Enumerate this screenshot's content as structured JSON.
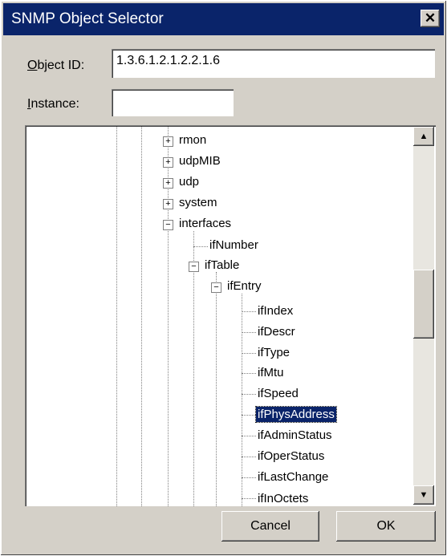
{
  "window": {
    "title": "SNMP Object Selector",
    "close_glyph": "✕"
  },
  "object_id": {
    "label_prefix": "O",
    "label_rest": "bject ID:",
    "value": "1.3.6.1.2.1.2.2.1.6"
  },
  "instance": {
    "label_prefix": "I",
    "label_rest": "nstance:",
    "value": ""
  },
  "tree": {
    "nodes": [
      {
        "label": "rmon",
        "expander": "+"
      },
      {
        "label": "udpMIB",
        "expander": "+"
      },
      {
        "label": "udp",
        "expander": "+"
      },
      {
        "label": "system",
        "expander": "+"
      },
      {
        "label": "interfaces",
        "expander": "−"
      },
      {
        "label": "ifNumber"
      },
      {
        "label": "ifTable",
        "expander": "−"
      },
      {
        "label": "ifEntry",
        "expander": "−"
      },
      {
        "label": "ifIndex"
      },
      {
        "label": "ifDescr"
      },
      {
        "label": "ifType"
      },
      {
        "label": "ifMtu"
      },
      {
        "label": "ifSpeed"
      },
      {
        "label": "ifPhysAddress",
        "selected": true
      },
      {
        "label": "ifAdminStatus"
      },
      {
        "label": "ifOperStatus"
      },
      {
        "label": "ifLastChange"
      },
      {
        "label": "ifInOctets"
      }
    ]
  },
  "scrollbar": {
    "up_glyph": "▲",
    "down_glyph": "▼"
  },
  "buttons": {
    "cancel": "Cancel",
    "ok": "OK"
  },
  "colors": {
    "titlebar": "#0a246a",
    "selection": "#0a246a",
    "face": "#d4d0c8"
  }
}
